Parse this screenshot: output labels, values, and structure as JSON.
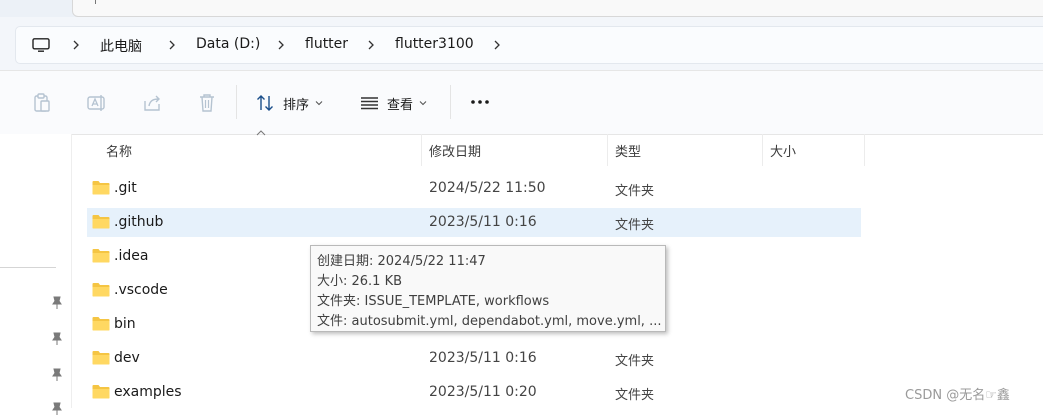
{
  "tabstrip": {
    "caret": "|"
  },
  "breadcrumb": {
    "items": [
      "此电脑",
      "Data (D:)",
      "flutter",
      "flutter3100"
    ]
  },
  "toolbar": {
    "sort_label": "排序",
    "view_label": "查看",
    "more_label": "更多"
  },
  "columns": {
    "name": "名称",
    "modified": "修改日期",
    "type": "类型",
    "size": "大小"
  },
  "files": [
    {
      "name": ".git",
      "modified": "2024/5/22 11:50",
      "type": "文件夹"
    },
    {
      "name": ".github",
      "modified": "2023/5/11 0:16",
      "type": "文件夹"
    },
    {
      "name": ".idea",
      "modified": "",
      "type": ""
    },
    {
      "name": ".vscode",
      "modified": "",
      "type": ""
    },
    {
      "name": "bin",
      "modified": "",
      "type": ""
    },
    {
      "name": "dev",
      "modified": "2023/5/11 0:16",
      "type": "文件夹"
    },
    {
      "name": "examples",
      "modified": "2023/5/11 0:20",
      "type": "文件夹"
    }
  ],
  "tooltip": {
    "created": "创建日期: 2024/5/22 11:47",
    "size": "大小: 26.1 KB",
    "folders": "文件夹: ISSUE_TEMPLATE, workflows",
    "files": "文件: autosubmit.yml, dependabot.yml, move.yml, ..."
  },
  "watermark": "CSDN @无名☞鑫",
  "colors": {
    "selection": "#e6f1fb",
    "folder": "#f5c543",
    "accent": "#0067c0"
  }
}
